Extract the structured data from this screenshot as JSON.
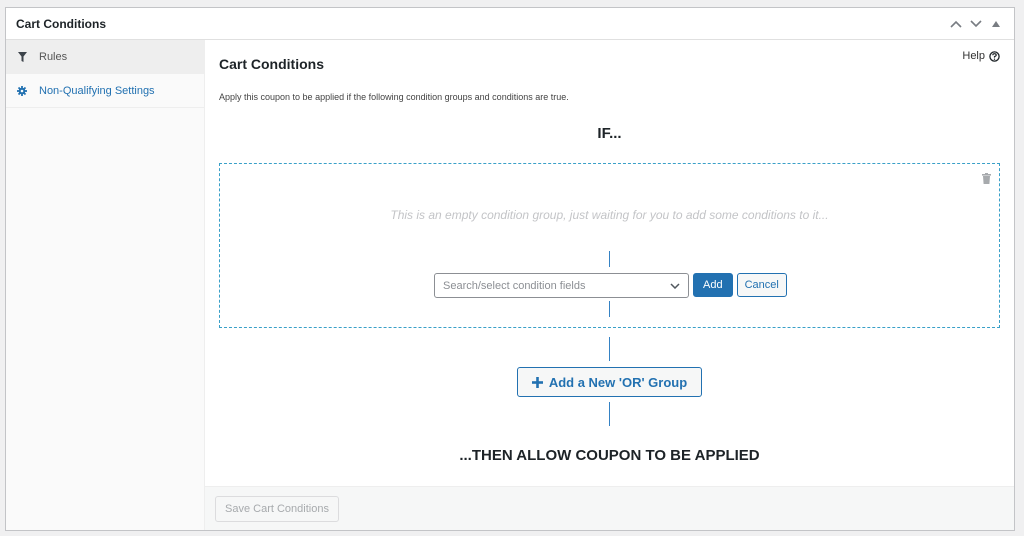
{
  "postbox": {
    "title": "Cart Conditions",
    "actions": [
      "move-up",
      "move-down",
      "toggle-panel"
    ]
  },
  "sidebar": {
    "items": [
      {
        "label": "Rules",
        "icon": "filter-icon",
        "active": true
      },
      {
        "label": "Non-Qualifying Settings",
        "icon": "gear-icon",
        "active": false
      }
    ]
  },
  "main": {
    "help_label": "Help",
    "title": "Cart Conditions",
    "description": "Apply this coupon to be applied if the following condition groups and conditions are true.",
    "if_label": "IF...",
    "group": {
      "empty_message": "This is an empty condition group, just waiting for you to add some conditions to it...",
      "select_placeholder": "Search/select condition fields",
      "add_label": "Add",
      "cancel_label": "Cancel"
    },
    "add_or_group_label": "Add a New 'OR' Group",
    "then_label": "...THEN ALLOW COUPON TO BE APPLIED"
  },
  "footer": {
    "save_label": "Save Cart Conditions",
    "save_disabled": true
  },
  "colors": {
    "accent": "#2271b1",
    "dashed_border": "#3aa0c8",
    "muted_text": "#c3c4c7"
  }
}
